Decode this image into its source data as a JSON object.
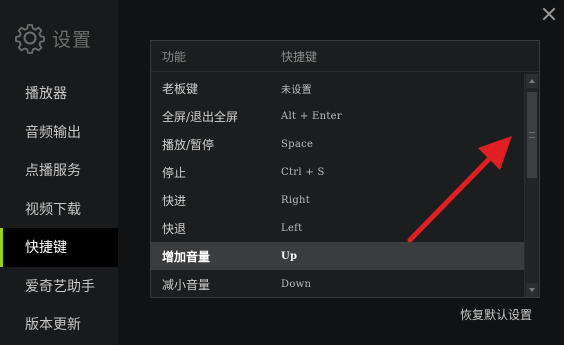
{
  "app": {
    "title": "设置"
  },
  "sidebar": {
    "items": [
      {
        "label": "播放器"
      },
      {
        "label": "音频输出"
      },
      {
        "label": "点播服务"
      },
      {
        "label": "视频下载"
      },
      {
        "label": "快捷键"
      },
      {
        "label": "爱奇艺助手"
      },
      {
        "label": "版本更新"
      }
    ],
    "active_index": 4,
    "accent_color": "#9ad018"
  },
  "table": {
    "headers": {
      "function": "功能",
      "shortcut": "快捷键"
    },
    "rows": [
      {
        "name": "老板键",
        "key": "未设置"
      },
      {
        "name": "全屏/退出全屏",
        "key": "Alt + Enter"
      },
      {
        "name": "播放/暂停",
        "key": "Space"
      },
      {
        "name": "停止",
        "key": "Ctrl + S"
      },
      {
        "name": "快进",
        "key": "Right"
      },
      {
        "name": "快退",
        "key": "Left"
      },
      {
        "name": "增加音量",
        "key": "Up"
      },
      {
        "name": "减小音量",
        "key": "Down"
      }
    ],
    "selected_index": 6
  },
  "footer": {
    "restore_label": "恢复默认设置"
  },
  "annotation": {
    "arrow_color": "#e02020"
  },
  "icons": {
    "brand": "gear-icon",
    "close": "close-icon"
  }
}
